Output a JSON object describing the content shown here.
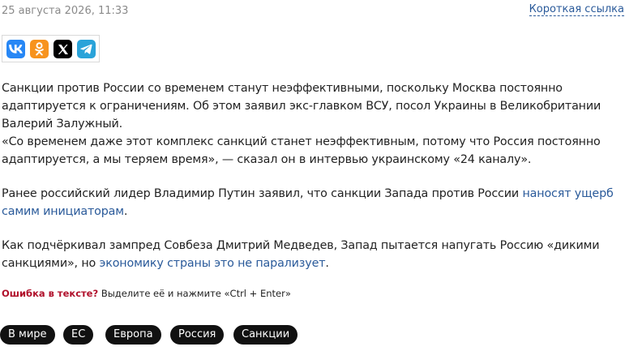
{
  "meta": {
    "date": "25 августа 2026, 11:33",
    "short_link_label": "Короткая ссылка"
  },
  "share": {
    "buttons": [
      {
        "name": "vk",
        "icon": "vk-icon",
        "color": "#2787f5"
      },
      {
        "name": "odnoklassniki",
        "icon": "odnoklassniki-icon",
        "color": "#f7931e"
      },
      {
        "name": "x",
        "icon": "x-icon",
        "color": "#000000"
      },
      {
        "name": "telegram",
        "icon": "telegram-icon",
        "color": "#2aa3d9"
      }
    ]
  },
  "article": {
    "p1": "Санкции против России со временем станут неэффективными, поскольку Москва постоянно адаптируется к ограничениям. Об этом заявил экс-главком ВСУ, посол Украины в Великобритании Валерий Залужный.",
    "p2": "«Со временем даже этот комплекс санкций станет неэффективным, потому что Россия постоянно адаптируется, а мы теряем время», — сказал он в интервью украинскому «24 каналу».",
    "p3_text": "Ранее российский лидер Владимир Путин заявил, что санкции Запада против России ",
    "p3_link": "наносят ущерб самим инициаторам",
    "p3_end": ".",
    "p4_text": "Как подчёркивал зампред Совбеза Дмитрий Медведев, Запад пытается напугать Россию «дикими санкциями», но ",
    "p4_link": "экономику страны это не парализует",
    "p4_end": "."
  },
  "error_report": {
    "label": "Ошибка в тексте?",
    "hint": "Выделите её и нажмите «Ctrl + Enter»"
  },
  "tags": [
    "В мире",
    "ЕС",
    "Европа",
    "Россия",
    "Санкции"
  ],
  "colors": {
    "link": "#2a5a9a",
    "error_label": "#b0102b",
    "tag_bg": "#111111",
    "tag_text": "#ffffff"
  }
}
